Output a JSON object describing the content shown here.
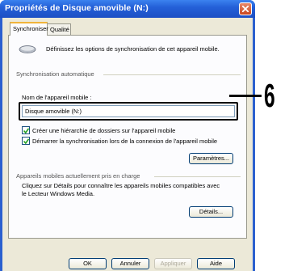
{
  "window": {
    "title": "Propriétés de Disque amovible (N:)",
    "close_icon": "close-icon"
  },
  "tabs": [
    {
      "label": "Synchroniser",
      "active": true
    },
    {
      "label": "Qualité",
      "active": false
    }
  ],
  "intro": {
    "icon": "removable-drive-icon",
    "text": "Définissez les options de synchronisation de cet appareil mobile."
  },
  "sync_group": {
    "title": "Synchronisation automatique",
    "device_name_label": "Nom de l'appareil mobile :",
    "device_name_value": "Disque amovible (N:)",
    "options": [
      {
        "label": "Créer une hiérarchie de dossiers sur l'appareil mobile",
        "checked": true
      },
      {
        "label": "Démarrer la synchronisation lors de la connexion de l'appareil mobile",
        "checked": true
      }
    ],
    "settings_button": "Paramètres..."
  },
  "supported_group": {
    "title": "Appareils mobiles actuellement pris en charge",
    "text_line1": "Cliquez sur Détails pour connaître les appareils mobiles compatibles avec",
    "text_line2": "le Lecteur Windows Media.",
    "details_button": "Détails..."
  },
  "footer": {
    "ok": "OK",
    "cancel": "Annuler",
    "apply": "Appliquer",
    "help": "Aide"
  },
  "callout": {
    "number": "6"
  }
}
